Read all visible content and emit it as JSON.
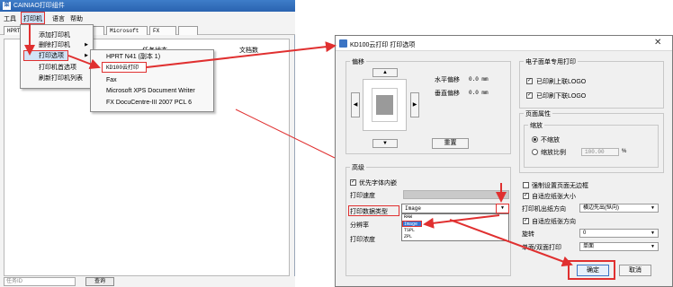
{
  "app": {
    "title": "CAINIAO打印组件",
    "menu": [
      "工具",
      "打印机",
      "语言",
      "帮助"
    ],
    "tabs": [
      "HPRT",
      "",
      "",
      "Microsoft",
      "FX",
      ""
    ],
    "columns": {
      "status": "任务状态",
      "docs": "文档数"
    },
    "task_placeholder": "任务ID",
    "query_label": "查询"
  },
  "printer_menu": {
    "items": [
      "添加打印机",
      "删除打印机",
      "打印选项",
      "打印机首选项",
      "刷新打印机列表"
    ]
  },
  "sub_menu": {
    "items": [
      "HPRT N41 (副本 1)",
      "KD100云打印",
      "Fax",
      "Microsoft XPS Document Writer",
      "FX DocuCentre-III 2007 PCL 6"
    ]
  },
  "dialog": {
    "title": "KD100云打印 打印选项",
    "offset": {
      "title": "偏移",
      "h_label": "水平偏移",
      "v_label": "垂直偏移",
      "h_value": "0.0 mm",
      "v_value": "0.0 mm",
      "reset_label": "重置"
    },
    "paper_group": {
      "title": "电子面单专用打印",
      "top_logo": "已印刷上联LOGO",
      "bottom_logo": "已印刷下联LOGO"
    },
    "props": {
      "title": "页面属性",
      "scale_title": "缩放",
      "no_scale": "不缩放",
      "scale_ratio": "缩放比例",
      "scale_value": "100.00",
      "percent": "%"
    },
    "advanced": {
      "title": "高级",
      "font_priority": "优先字体内嵌",
      "speed_label": "打印速度",
      "datatype_label": "打印数据类型",
      "datatype_value": "Image",
      "resolution_label": "分辨率",
      "density_label": "打印浓度",
      "datatype_options": [
        "RAW",
        "Image",
        "TSPL",
        "ZPL"
      ]
    },
    "right_opts": {
      "force_no_border": "强制设置页面无边框",
      "auto_paper_size": "自适应纸张大小",
      "paper_out_dir_label": "打印机出纸方向",
      "paper_out_dir_value": "横边先出(纵向)",
      "auto_paper_dir": "自适应纸张方向",
      "rotate_label": "旋转",
      "rotate_value": "0",
      "duplex_label": "单面/双面打印",
      "duplex_value": "单面"
    },
    "ok_label": "确定",
    "cancel_label": "取消"
  },
  "colors": {
    "highlight_red": "#e03030",
    "title_blue": "#2a63b0",
    "selection_blue": "#3375d6"
  }
}
